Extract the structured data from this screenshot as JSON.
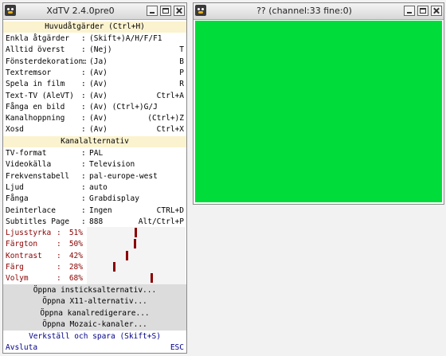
{
  "menu_window": {
    "title": "XdTV 2.4.0pre0",
    "main_section_title": "Huvudåtgärder (Ctrl+H)",
    "main_rows": [
      {
        "label": "Enkla åtgärder",
        "value": "(Skift+)A/H/F/F1",
        "key": ""
      },
      {
        "label": "Alltid överst",
        "value": "(Nej)",
        "key": "T"
      },
      {
        "label": "Fönsterdekoration:",
        "value": "(Ja)",
        "key": "B"
      },
      {
        "label": "Textremsor",
        "value": "(Av)",
        "key": "P"
      },
      {
        "label": "Spela in film",
        "value": "(Av)",
        "key": "R"
      },
      {
        "label": "Text-TV (AleVT)",
        "value": "(Av)",
        "key": "Ctrl+A"
      },
      {
        "label": "Fånga en bild",
        "value": "(Av) (Ctrl+)G/J",
        "key": ""
      },
      {
        "label": "Kanalhoppning",
        "value": "(Av)",
        "key": "(Ctrl+)Z"
      },
      {
        "label": "Xosd",
        "value": "(Av)",
        "key": "Ctrl+X"
      }
    ],
    "channel_section_title": "Kanalalternativ",
    "channel_rows": [
      {
        "label": "TV-format",
        "value": "PAL",
        "key": ""
      },
      {
        "label": "Videokälla",
        "value": "Television",
        "key": ""
      },
      {
        "label": "Frekvenstabell",
        "value": "pal-europe-west",
        "key": ""
      },
      {
        "label": "Ljud",
        "value": "auto",
        "key": ""
      },
      {
        "label": "Fånga",
        "value": "Grabdisplay",
        "key": ""
      },
      {
        "label": "Deinterlace",
        "value": "Ingen",
        "key": "CTRL+D"
      },
      {
        "label": "Subtitles Page",
        "value": "888",
        "key": "Alt/Ctrl+P"
      }
    ],
    "video_rows": [
      {
        "label": "Ljusstyrka",
        "value": "51%",
        "level": 0.51
      },
      {
        "label": "Färgton",
        "value": "50%",
        "level": 0.5
      },
      {
        "label": "Kontrast",
        "value": "42%",
        "level": 0.42
      },
      {
        "label": "Färg",
        "value": "28%",
        "level": 0.28
      },
      {
        "label": "Volym",
        "value": "68%",
        "level": 0.68
      }
    ],
    "buttons": [
      "Öppna insticksalternativ...",
      "Öppna X11-alternativ...",
      "Öppna kanalredigerare...",
      "Öppna Mozaic-kanaler..."
    ],
    "save_label": "Verkställ och spara (Skift+S)",
    "quit_label": "Avsluta",
    "quit_key": "ESC"
  },
  "tv_window": {
    "title": "?? (channel:33 fine:0)",
    "screen_color": "#00dd3a"
  },
  "colors": {
    "section_bg": "#fbf3cf",
    "video_label": "#8b0000",
    "action_text": "#00008b"
  }
}
